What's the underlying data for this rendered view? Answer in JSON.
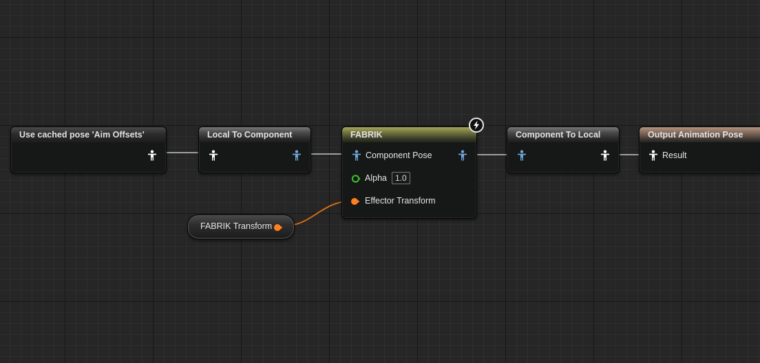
{
  "graph": {
    "nodes": {
      "cached_pose": {
        "title": "Use cached pose 'Aim Offsets'"
      },
      "local_to_component": {
        "title": "Local To Component"
      },
      "fabrik": {
        "title": "FABRIK",
        "pins": {
          "component_pose": "Component Pose",
          "alpha": "Alpha",
          "alpha_value": "1.0",
          "effector_transform": "Effector Transform"
        },
        "badge_icon": "lightning-icon"
      },
      "component_to_local": {
        "title": "Component To Local"
      },
      "output_pose": {
        "title": "Output Animation Pose",
        "pins": {
          "result": "Result"
        }
      },
      "fabrik_transform_getter": {
        "label": "FABRIK Transform"
      }
    },
    "colors": {
      "pose_local": "#ffffff",
      "pose_component": "#6fa8dc",
      "float_pin": "#39c12c",
      "transform_pin": "#ff7f1e",
      "wire_pose": "#c8c8c8",
      "wire_transform": "#e07010"
    },
    "icons": {
      "pose_pin": "person-icon",
      "float_pin": "ring-icon",
      "transform_pin": "circle-icon"
    }
  }
}
